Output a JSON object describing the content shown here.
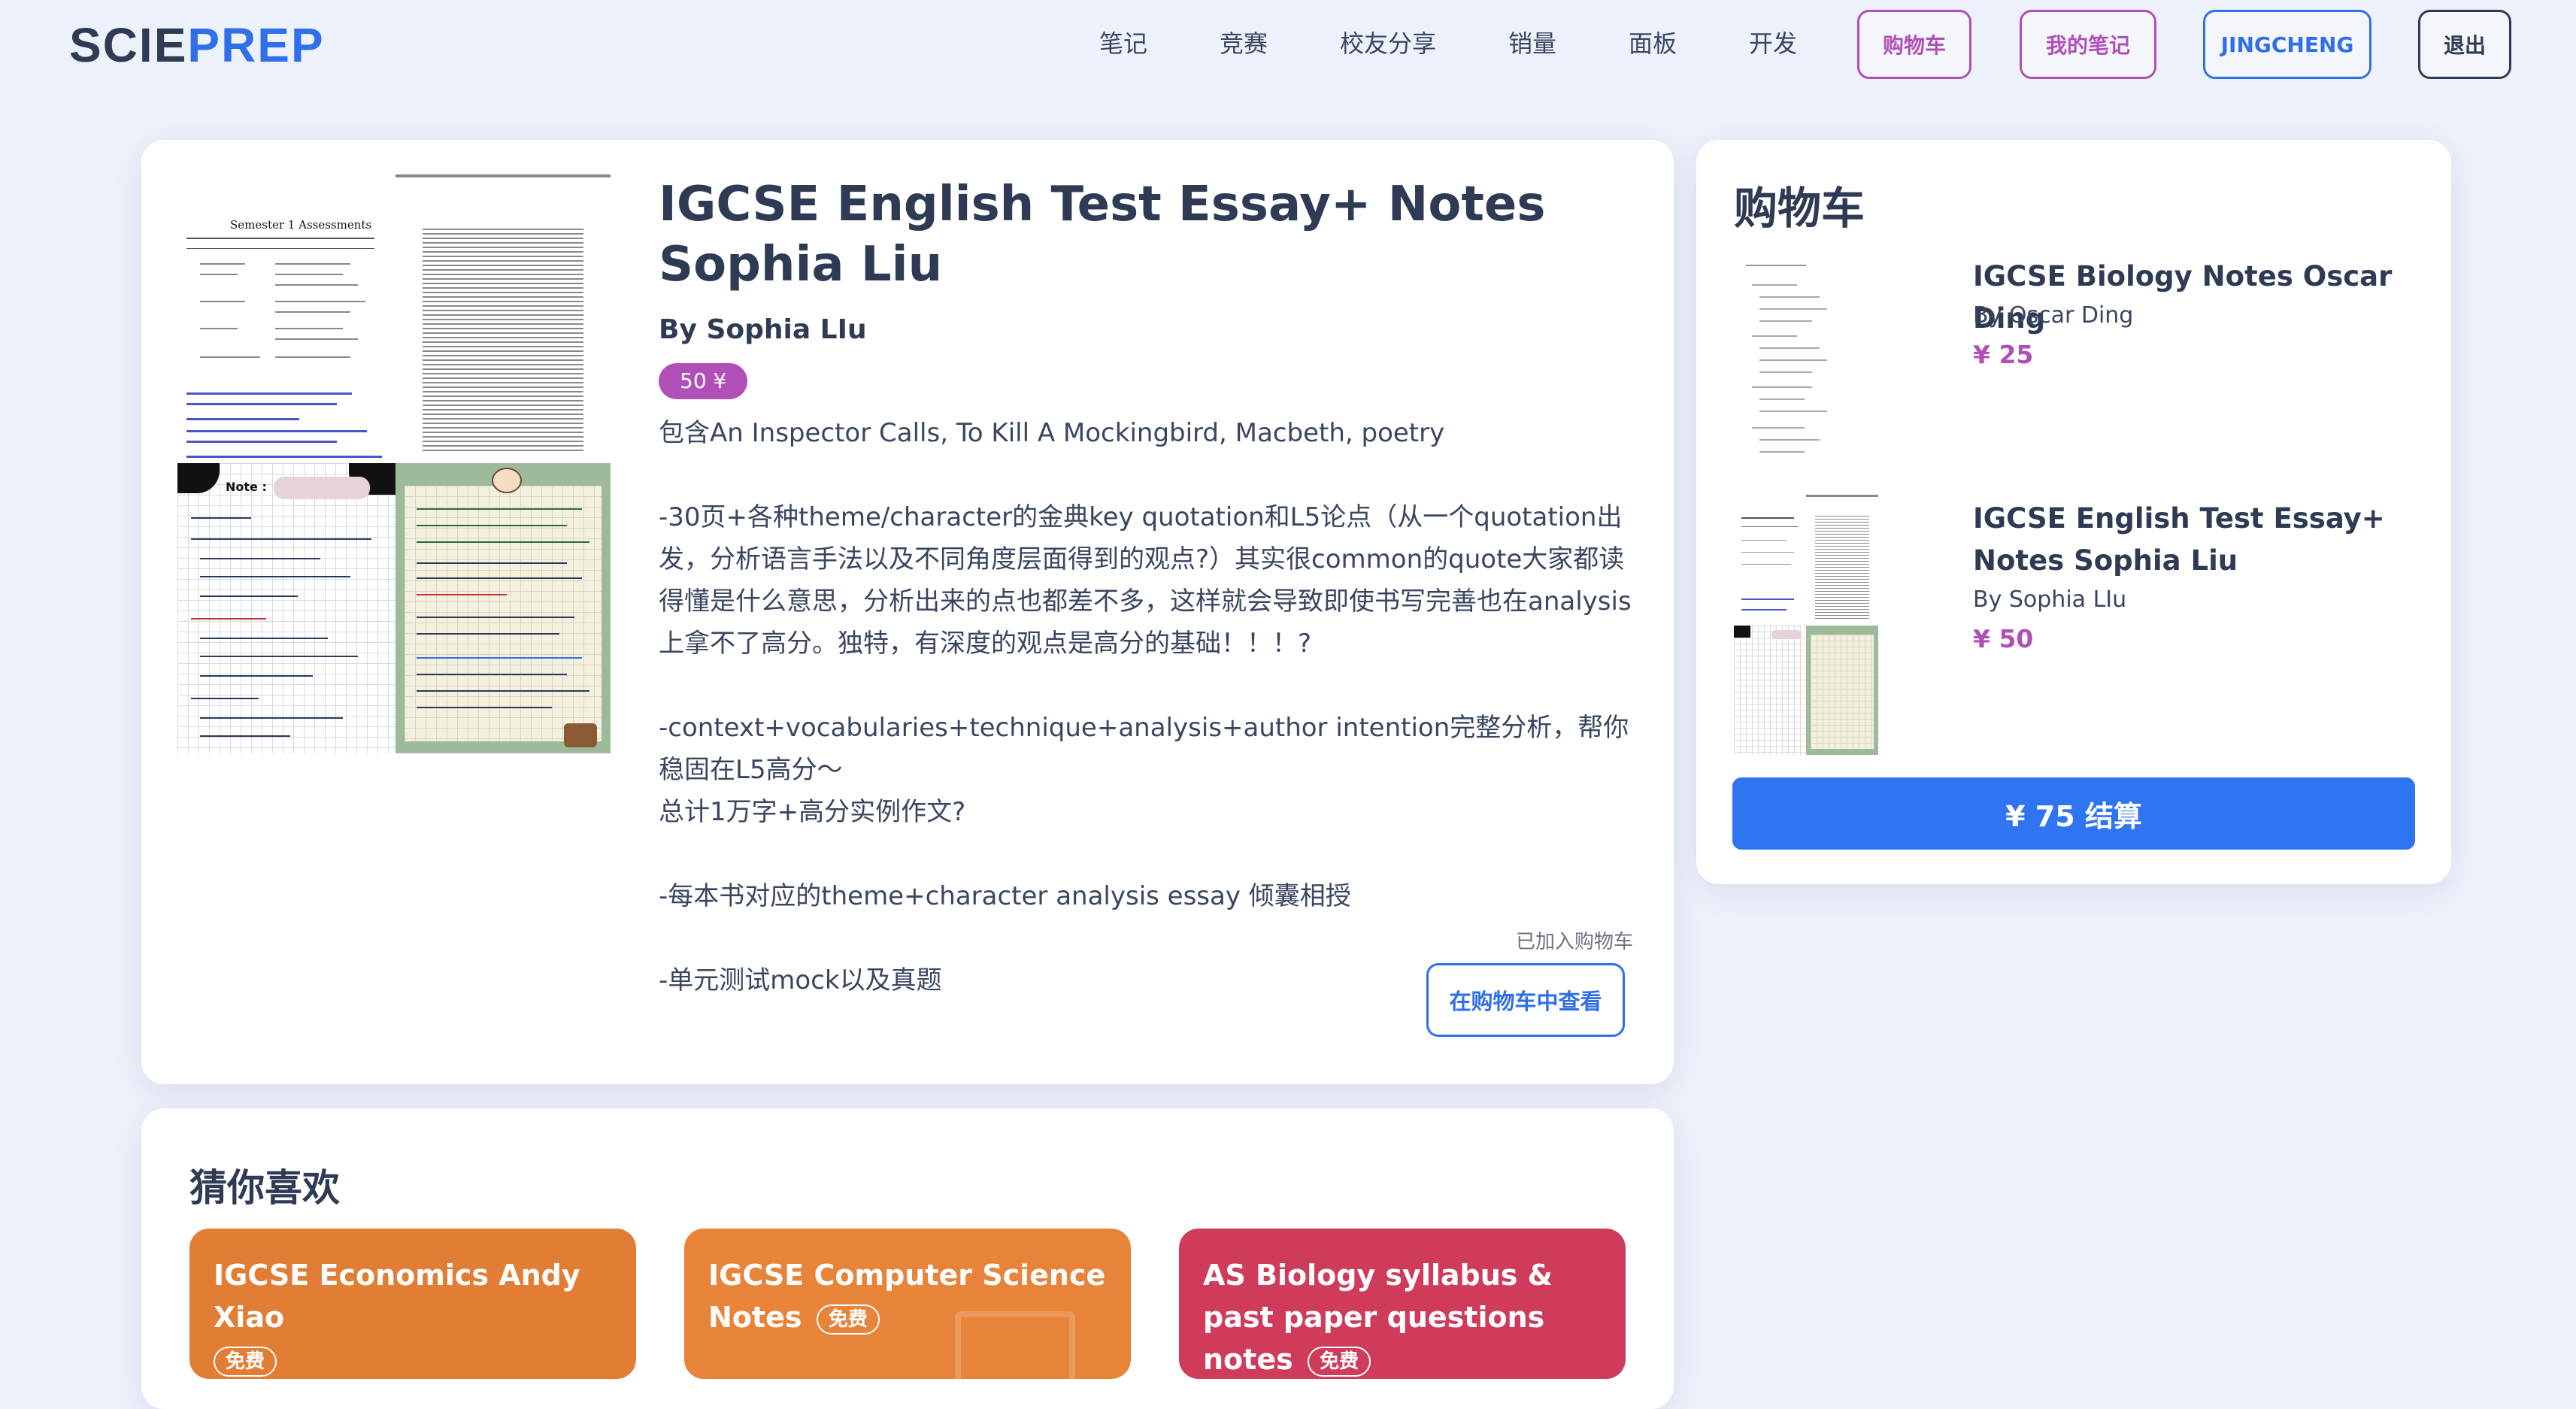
{
  "header": {
    "logo_part1": "SCIE",
    "logo_part2": "PREP",
    "nav": [
      "笔记",
      "竞赛",
      "校友分享",
      "销量",
      "面板",
      "开发"
    ],
    "cart_button": "购物车",
    "my_notes_button": "我的笔记",
    "user_button": "JINGCHENG",
    "logout_button": "退出"
  },
  "product": {
    "title": "IGCSE English Test Essay+ Notes Sophia Liu",
    "author": "By Sophia LIu",
    "price_badge": "50 ¥",
    "contents": "包含An Inspector Calls, To Kill A Mockingbird, Macbeth, poetry",
    "desc1": "-30页+各种theme/character的金典key quotation和L5论点（从一个quotation出发，分析语言手法以及不同角度层面得到的观点?）其实很common的quote大家都读得懂是什么意思，分析出来的点也都差不多，这样就会导致即使书写完善也在analysis上拿不了高分。独特，有深度的观点是高分的基础！！！?",
    "desc2": "-context+vocabularies+technique+analysis+author intention完整分析，帮你稳固在L5高分～",
    "desc3": "总计1万字+高分实例作文?",
    "desc4": "-每本书对应的theme+character analysis essay 倾囊相授",
    "desc5": "-单元测试mock以及真题",
    "added_label": "已加入购物车",
    "view_cart_button": "在购物车中查看",
    "preview": {
      "doc_heading": "Semester 1 Assessments",
      "note_label": "Note :"
    }
  },
  "cart": {
    "title": "购物车",
    "items": [
      {
        "title": "IGCSE Biology Notes Oscar Ding",
        "author": "By Oscar Ding",
        "price": "¥ 25"
      },
      {
        "title": "IGCSE English Test Essay+ Notes Sophia Liu",
        "author": "By Sophia LIu",
        "price": "¥ 50"
      }
    ],
    "checkout_button": "¥ 75 结算"
  },
  "recommend": {
    "title": "猜你喜欢",
    "free_label": "免费",
    "items": [
      {
        "title": "IGCSE Economics Andy Xiao",
        "color": "#e27d36"
      },
      {
        "title": "IGCSE Computer Science Notes",
        "color": "#e8833a"
      },
      {
        "title": "AS Biology syllabus & past paper questions notes",
        "color": "#cf3b5a"
      }
    ]
  }
}
